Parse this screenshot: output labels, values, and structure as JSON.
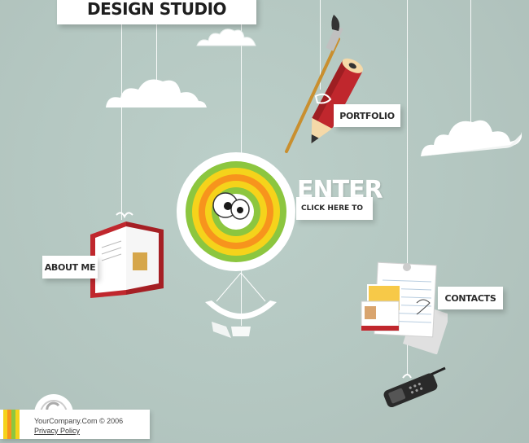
{
  "header": {
    "title": "DESIGN STUDIO"
  },
  "nav": {
    "portfolio": "PORTFOLIO",
    "about": "ABOUT ME",
    "contacts": "CONTACTS"
  },
  "enter": {
    "word": "ENTER",
    "hint": "CLICK HERE TO"
  },
  "footer": {
    "copyright": "YourCompany.Com © 2006",
    "privacy": "Privacy Policy"
  },
  "colors": {
    "background": "#b6c9c3",
    "ring_green": "#8cc63f",
    "ring_yellow": "#f5d31b",
    "ring_orange": "#f7941d",
    "accent_red": "#c0272d"
  },
  "icons": [
    "cloud-icon",
    "pencil-brush-icon",
    "book-icon",
    "papers-icon",
    "mobile-phone-icon",
    "copyright-icon",
    "target-eyes-icon"
  ]
}
